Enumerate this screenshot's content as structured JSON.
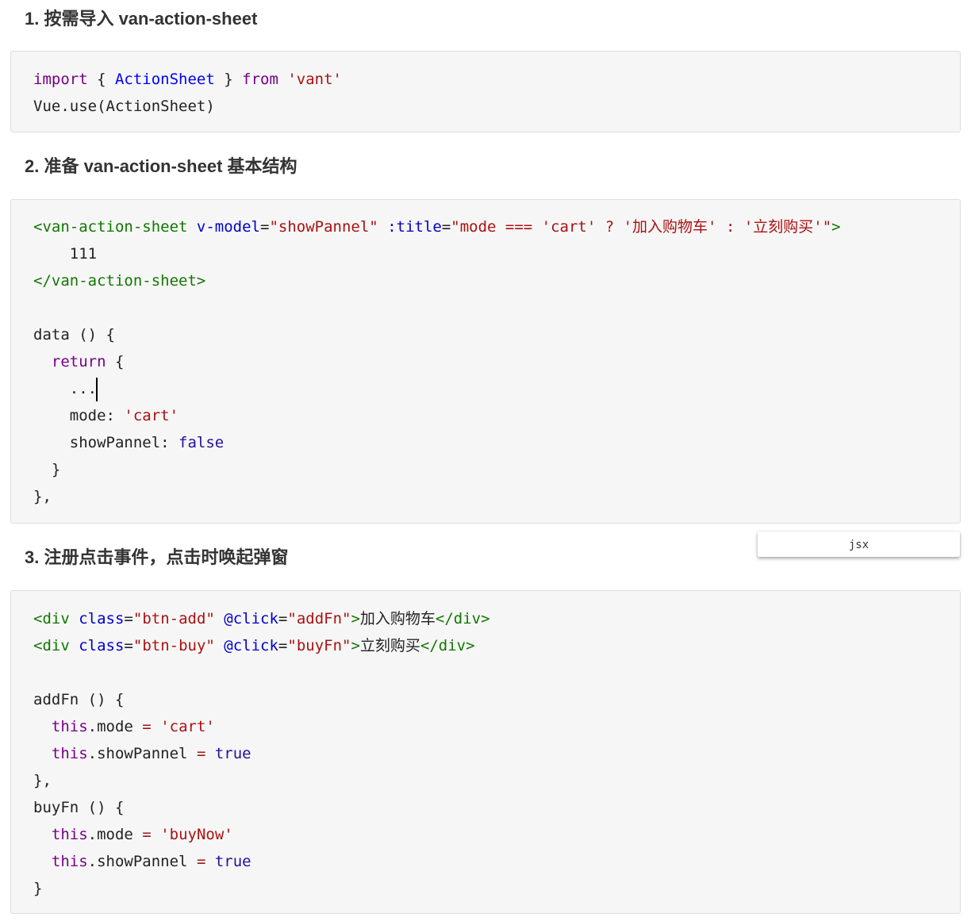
{
  "headings": [
    "1. 按需导入 van-action-sheet",
    "2. 准备 van-action-sheet 基本结构",
    "3. 注册点击事件，点击时唤起弹窗"
  ],
  "language_tooltip": "jsx",
  "block1": [
    [
      [
        "kw",
        "import"
      ],
      [
        "plain",
        " { "
      ],
      [
        "def",
        "ActionSheet"
      ],
      [
        "plain",
        " } "
      ],
      [
        "kw",
        "from"
      ],
      [
        "plain",
        " "
      ],
      [
        "str",
        "'vant'"
      ]
    ],
    [
      [
        "plain",
        "Vue.use(ActionSheet)"
      ]
    ]
  ],
  "block2": [
    [
      [
        "tag",
        "<van-action-sheet"
      ],
      [
        "plain",
        " "
      ],
      [
        "attr",
        "v-model"
      ],
      [
        "plain",
        "="
      ],
      [
        "str",
        "\"showPannel\""
      ],
      [
        "plain",
        " "
      ],
      [
        "attr",
        ":title"
      ],
      [
        "plain",
        "="
      ],
      [
        "str",
        "\"mode === 'cart' ? '加入购物车' : '立刻购买'\""
      ],
      [
        "tag",
        ">"
      ]
    ],
    [
      [
        "plain",
        "    111"
      ]
    ],
    [
      [
        "tag",
        "</van-action-sheet>"
      ]
    ],
    [
      [
        "plain",
        ""
      ]
    ],
    [
      [
        "plain",
        "data () {"
      ]
    ],
    [
      [
        "plain",
        "  "
      ],
      [
        "kw",
        "return"
      ],
      [
        "plain",
        " {"
      ]
    ],
    [
      [
        "plain",
        "    ..."
      ],
      [
        "cursor",
        ""
      ]
    ],
    [
      [
        "plain",
        "    mode: "
      ],
      [
        "str",
        "'cart'"
      ]
    ],
    [
      [
        "plain",
        "    showPannel: "
      ],
      [
        "atom",
        "false"
      ]
    ],
    [
      [
        "plain",
        "  }"
      ]
    ],
    [
      [
        "plain",
        "},"
      ]
    ]
  ],
  "block3": [
    [
      [
        "tag",
        "<div"
      ],
      [
        "plain",
        " "
      ],
      [
        "attr",
        "class"
      ],
      [
        "plain",
        "="
      ],
      [
        "str",
        "\"btn-add\""
      ],
      [
        "plain",
        " "
      ],
      [
        "attr",
        "@click"
      ],
      [
        "plain",
        "="
      ],
      [
        "str",
        "\"addFn\""
      ],
      [
        "tag",
        ">"
      ],
      [
        "plain",
        "加入购物车"
      ],
      [
        "tag",
        "</div>"
      ]
    ],
    [
      [
        "tag",
        "<div"
      ],
      [
        "plain",
        " "
      ],
      [
        "attr",
        "class"
      ],
      [
        "plain",
        "="
      ],
      [
        "str",
        "\"btn-buy\""
      ],
      [
        "plain",
        " "
      ],
      [
        "attr",
        "@click"
      ],
      [
        "plain",
        "="
      ],
      [
        "str",
        "\"buyFn\""
      ],
      [
        "tag",
        ">"
      ],
      [
        "plain",
        "立刻购买"
      ],
      [
        "tag",
        "</div>"
      ]
    ],
    [
      [
        "plain",
        ""
      ]
    ],
    [
      [
        "plain",
        "addFn () {"
      ]
    ],
    [
      [
        "plain",
        "  "
      ],
      [
        "kw",
        "this"
      ],
      [
        "plain",
        ".mode "
      ],
      [
        "op",
        "="
      ],
      [
        "plain",
        " "
      ],
      [
        "str",
        "'cart'"
      ]
    ],
    [
      [
        "plain",
        "  "
      ],
      [
        "kw",
        "this"
      ],
      [
        "plain",
        ".showPannel "
      ],
      [
        "op",
        "="
      ],
      [
        "plain",
        " "
      ],
      [
        "atom",
        "true"
      ]
    ],
    [
      [
        "plain",
        "},"
      ]
    ],
    [
      [
        "plain",
        "buyFn () {"
      ]
    ],
    [
      [
        "plain",
        "  "
      ],
      [
        "kw",
        "this"
      ],
      [
        "plain",
        ".mode "
      ],
      [
        "op",
        "="
      ],
      [
        "plain",
        " "
      ],
      [
        "str",
        "'buyNow'"
      ]
    ],
    [
      [
        "plain",
        "  "
      ],
      [
        "kw",
        "this"
      ],
      [
        "plain",
        ".showPannel "
      ],
      [
        "op",
        "="
      ],
      [
        "plain",
        " "
      ],
      [
        "atom",
        "true"
      ]
    ],
    [
      [
        "plain",
        "}"
      ]
    ]
  ]
}
